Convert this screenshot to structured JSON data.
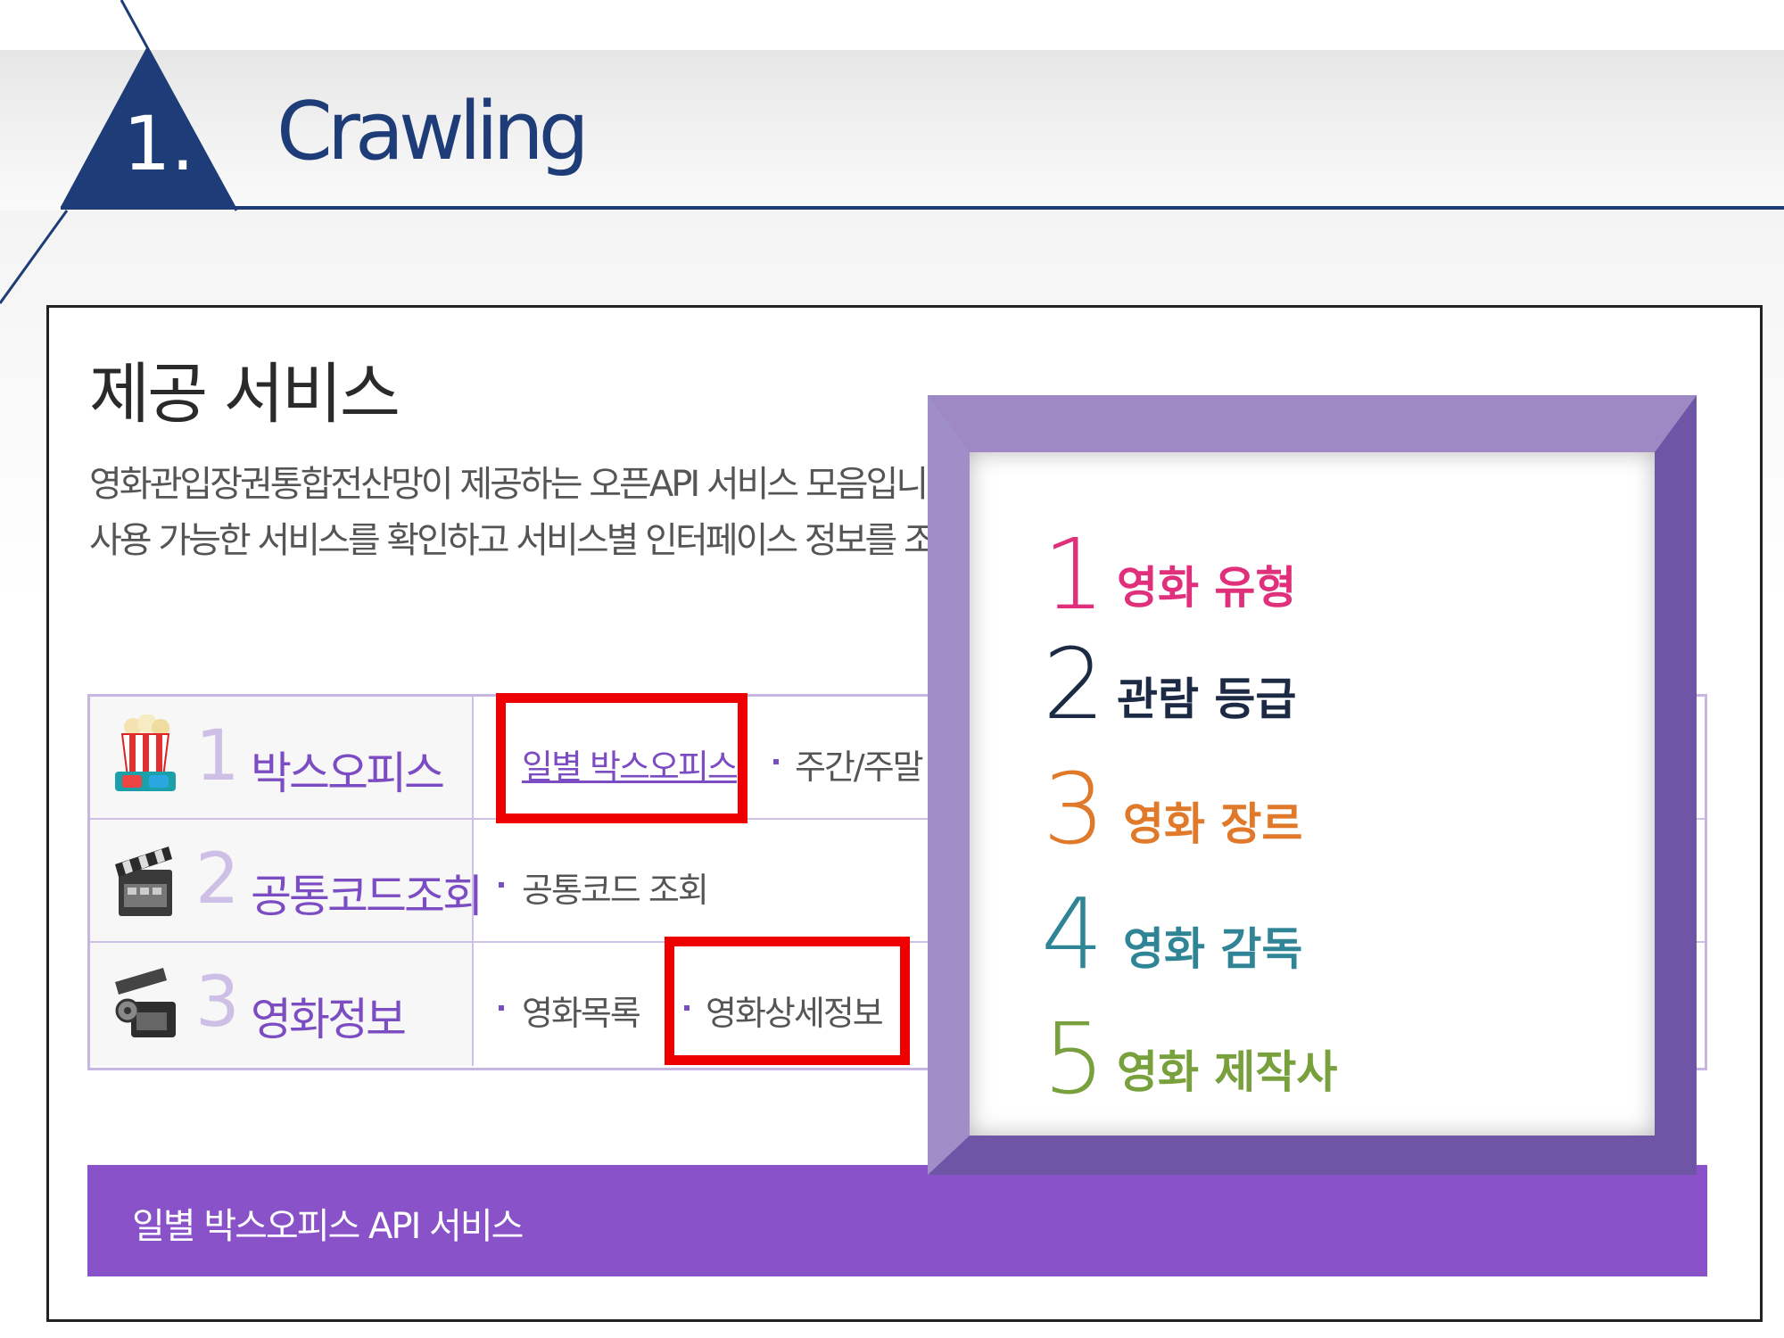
{
  "slide": {
    "section_number": "1.",
    "title": "Crawling",
    "accent_color": "#1d3c78"
  },
  "service_page": {
    "title": "제공 서비스",
    "description_lines": [
      "영화관입장권통합전산망이  제공하는 오픈API 서비스 모음입니다.",
      "사용 가능한 서비스를 확인하고 서비스별 인터페이스 정보를 조회합니다."
    ],
    "categories": [
      {
        "number": "1",
        "label": "박스오피스",
        "icon": "popcorn-icon",
        "services": [
          "일별 박스오피스",
          "주간/주말 박"
        ],
        "selected": "일별 박스오피스"
      },
      {
        "number": "2",
        "label": "공통코드조회",
        "icon": "clapperboard-icon",
        "services": [
          "공통코드 조회"
        ]
      },
      {
        "number": "3",
        "label": "영화정보",
        "icon": "film-camera-icon",
        "services": [
          "영화목록",
          "영화상세정보"
        ]
      }
    ],
    "api_bar_label": "일별 박스오피스 API 서비스",
    "accent_color": "#8a52c8",
    "highlight_color": "#ee0000"
  },
  "callout": {
    "frame_color": "#7b5bb0",
    "items": [
      {
        "number": "1",
        "label": "영화 유형",
        "color": "#e0307c"
      },
      {
        "number": "2",
        "label": "관람 등급",
        "color": "#1c2a44"
      },
      {
        "number": "3",
        "label": "영화 장르",
        "color": "#e0792a"
      },
      {
        "number": "4",
        "label": "영화 감독",
        "color": "#2f8596"
      },
      {
        "number": "5",
        "label": "영화 제작사",
        "color": "#78a03c"
      }
    ]
  }
}
